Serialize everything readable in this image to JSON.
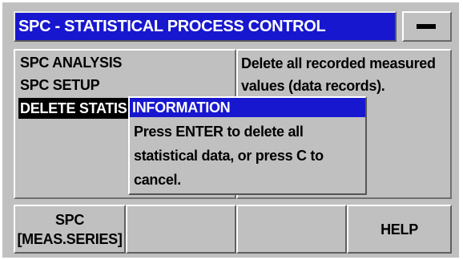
{
  "title_bar": {
    "title": "SPC - STATISTICAL PROCESS CONTROL",
    "indicator_icon": "minus-icon"
  },
  "menu": {
    "items": [
      {
        "label": "SPC ANALYSIS",
        "selected": false
      },
      {
        "label": "SPC SETUP",
        "selected": false
      },
      {
        "label": "DELETE STATIS",
        "selected": true
      }
    ]
  },
  "help_panel": {
    "text": "Delete all recorded measured values (data records)."
  },
  "popup": {
    "title": "INFORMATION",
    "lines": [
      "Press ENTER to delete all",
      "statistical data, or press C to",
      "cancel."
    ]
  },
  "softkeys": [
    {
      "line1": "SPC",
      "line2": "[MEAS.SERIES]"
    },
    {
      "line1": "",
      "line2": ""
    },
    {
      "line1": "",
      "line2": ""
    },
    {
      "line1": "HELP",
      "line2": ""
    }
  ],
  "colors": {
    "title_bar_bg": "#1717cf",
    "panel_bg": "#c0c0c0",
    "selected_bg": "#000000"
  }
}
